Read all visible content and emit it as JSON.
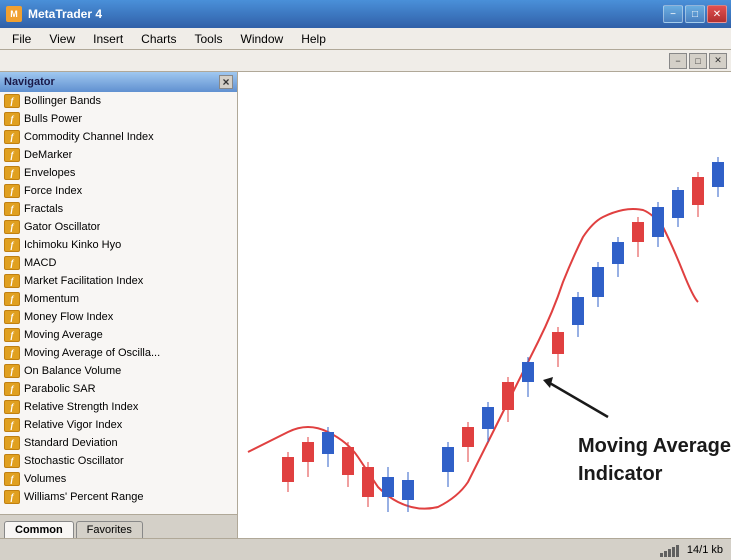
{
  "titleBar": {
    "title": "MetaTrader 4",
    "minimizeLabel": "−",
    "maximizeLabel": "□",
    "closeLabel": "✕"
  },
  "menuBar": {
    "items": [
      "File",
      "View",
      "Insert",
      "Charts",
      "Tools",
      "Window",
      "Help"
    ]
  },
  "innerBar": {
    "minimizeLabel": "−",
    "maximizeLabel": "□",
    "closeLabel": "✕"
  },
  "navigator": {
    "title": "Navigator",
    "closeLabel": "×",
    "items": [
      "Bollinger Bands",
      "Bulls Power",
      "Commodity Channel Index",
      "DeMarker",
      "Envelopes",
      "Force Index",
      "Fractals",
      "Gator Oscillator",
      "Ichimoku Kinko Hyo",
      "MACD",
      "Market Facilitation Index",
      "Momentum",
      "Money Flow Index",
      "Moving Average",
      "Moving Average of Oscilla...",
      "On Balance Volume",
      "Parabolic SAR",
      "Relative Strength Index",
      "Relative Vigor Index",
      "Standard Deviation",
      "Stochastic Oscillator",
      "Volumes",
      "Williams' Percent Range"
    ],
    "tabs": [
      {
        "label": "Common",
        "active": true
      },
      {
        "label": "Favorites",
        "active": false
      }
    ]
  },
  "chart": {
    "annotation": {
      "line1": "Moving Average",
      "line2": "Indicator"
    }
  },
  "statusBar": {
    "statusText": "14/1 kb"
  }
}
